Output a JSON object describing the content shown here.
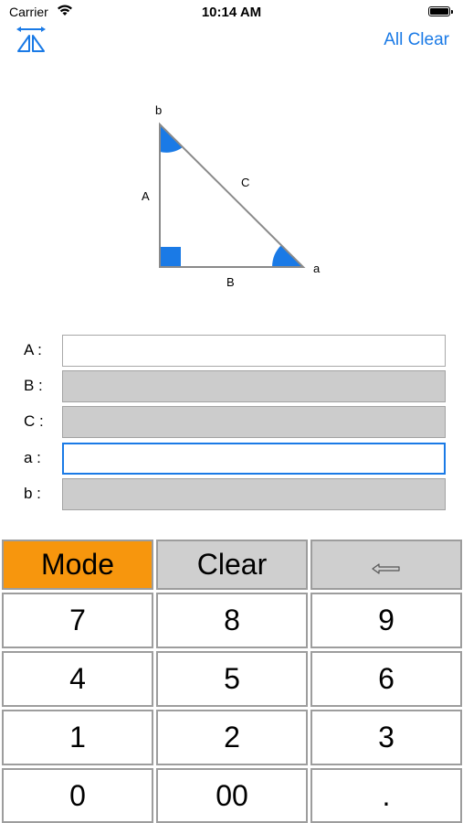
{
  "status_bar": {
    "carrier": "Carrier",
    "time": "10:14 AM"
  },
  "nav": {
    "mode_icon": "triangle-flip-icon",
    "all_clear_label": "All Clear"
  },
  "diagram": {
    "vertex_b": "b",
    "vertex_a": "a",
    "side_a": "A",
    "side_b": "B",
    "side_c": "C",
    "accent_color": "#1a7ae6"
  },
  "fields": [
    {
      "label": "A :",
      "value": "",
      "state": "enabled"
    },
    {
      "label": "B :",
      "value": "",
      "state": "disabled"
    },
    {
      "label": "C :",
      "value": "",
      "state": "disabled"
    },
    {
      "label": "a :",
      "value": "",
      "state": "focused"
    },
    {
      "label": "b :",
      "value": "",
      "state": "disabled"
    }
  ],
  "keypad": {
    "mode": "Mode",
    "clear": "Clear",
    "backspace_icon": "backspace-arrow-icon",
    "digits": [
      "7",
      "8",
      "9",
      "4",
      "5",
      "6",
      "1",
      "2",
      "3",
      "0",
      "00",
      "."
    ]
  },
  "colors": {
    "mode_key": "#f7960d",
    "gray_key": "#cfcfcf",
    "link": "#1a7ae6"
  }
}
